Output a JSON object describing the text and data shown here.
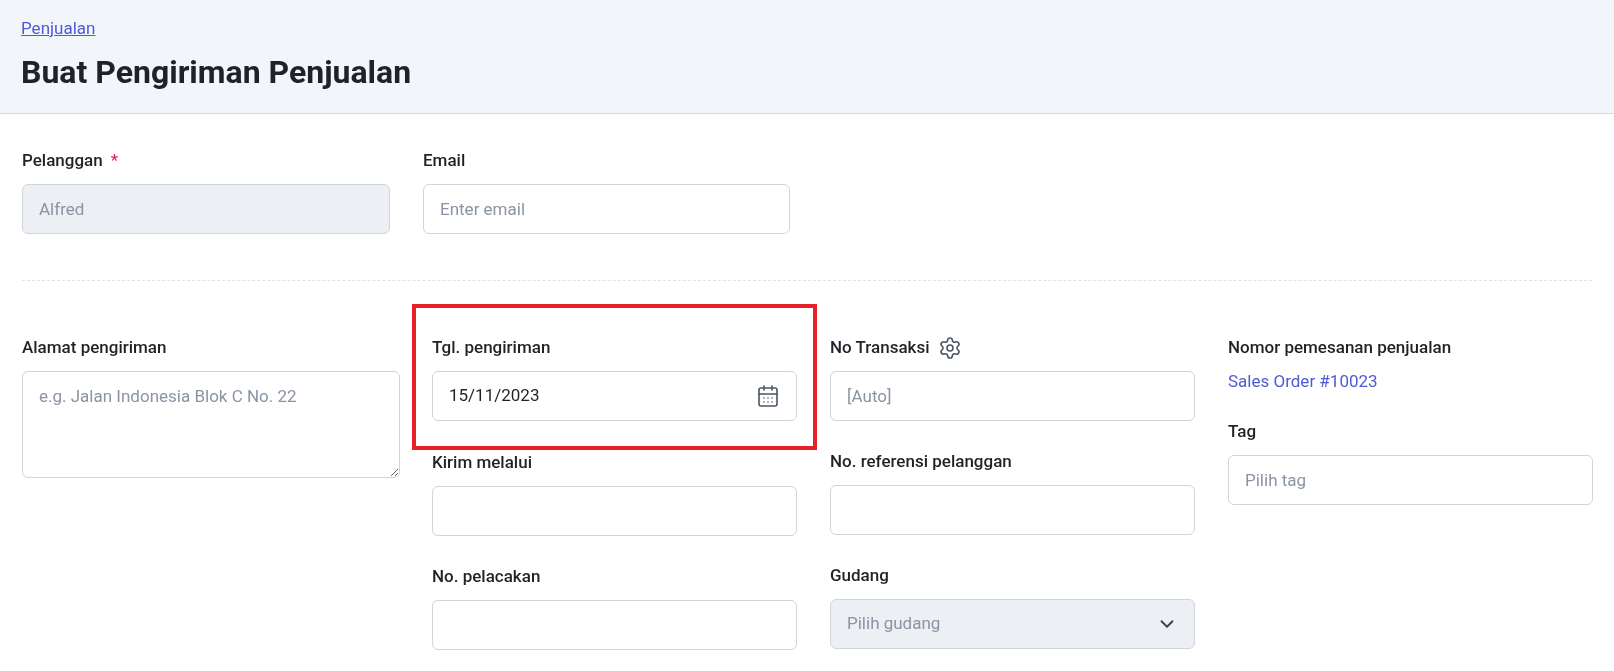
{
  "breadcrumb": "Penjualan",
  "title": "Buat Pengiriman Penjualan",
  "top_fields": [
    {
      "kind": "input",
      "label": "Pelanggan",
      "required_mark": "*",
      "disabled": true,
      "value": "Alfred"
    },
    {
      "kind": "input",
      "label": "Email",
      "disabled": false,
      "placeholder": "Enter email"
    }
  ],
  "columns": [
    [
      {
        "kind": "textarea",
        "label": "Alamat pengiriman",
        "placeholder": "e.g. Jalan Indonesia Blok C No. 22",
        "highlighted": false
      }
    ],
    [
      {
        "kind": "date",
        "label": "Tgl. pengiriman",
        "value": "15/11/2023",
        "highlighted": true
      },
      {
        "kind": "input",
        "label": "Kirim melalui",
        "highlighted": false
      },
      {
        "kind": "input",
        "label": "No. pelacakan",
        "highlighted": false
      }
    ],
    [
      {
        "kind": "input",
        "label": "No Transaksi",
        "settings": true,
        "placeholder": "[Auto]",
        "highlighted": false
      },
      {
        "kind": "input",
        "label": "No. referensi pelanggan",
        "highlighted": false
      },
      {
        "kind": "select",
        "label": "Gudang",
        "placeholder": "Pilih gudang",
        "disabled": true,
        "highlighted": false
      }
    ],
    [
      {
        "kind": "link",
        "label": "Nomor pemesanan penjualan",
        "value": "Sales Order #10023",
        "highlighted": false
      },
      {
        "kind": "input",
        "label": "Tag",
        "placeholder": "Pilih tag",
        "highlighted": false
      }
    ]
  ]
}
